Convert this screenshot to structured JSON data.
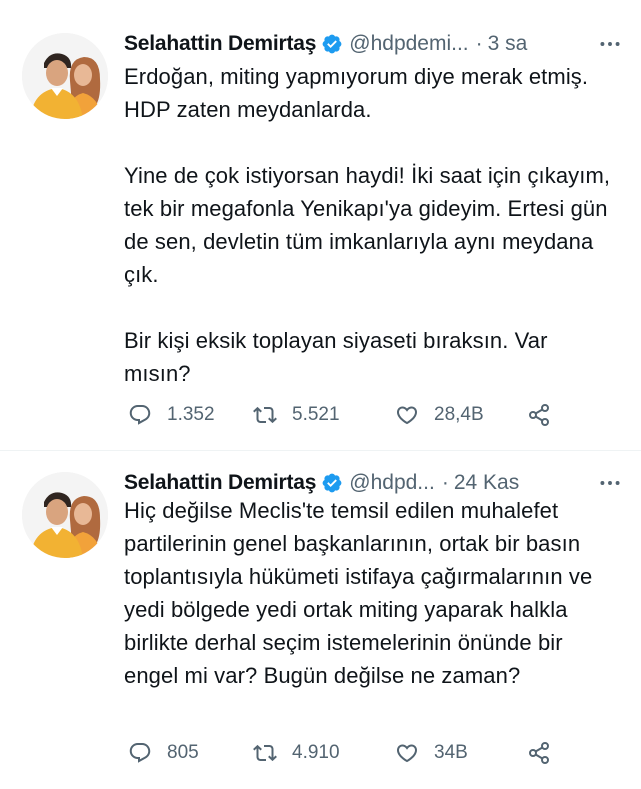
{
  "tweets": [
    {
      "author_name": "Selahattin Demirtaş",
      "handle": "@hdpdemi...",
      "separator": "·",
      "time": "3 sa",
      "text": "Erdoğan, miting yapmıyorum diye merak etmiş. HDP zaten meydanlarda.\n\nYine de çok istiyorsan haydi! İki saat için çıkayım, tek bir megafonla Yenikapı'ya gideyim. Ertesi gün de sen, devletin tüm imkanlarıyla aynı meydana çık.\n\nBir kişi eksik toplayan siyaseti bıraksın. Var mısın?",
      "replies": "1.352",
      "retweets": "5.521",
      "likes": "28,4B"
    },
    {
      "author_name": "Selahattin Demirtaş",
      "handle": "@hdpd...",
      "separator": "·",
      "time": "24 Kas",
      "text": "Hiç değilse Meclis'te temsil edilen muhalefet partilerinin genel başkanlarının, ortak bir basın toplantısıyla hükümeti istifaya çağırmalarının ve yedi bölgede yedi ortak miting yaparak halkla birlikte derhal seçim istemelerinin önünde bir engel mi var? Bugün değilse ne zaman?",
      "replies": "805",
      "retweets": "4.910",
      "likes": "34B"
    }
  ],
  "colors": {
    "text": "#0f1419",
    "secondary": "#536471",
    "verified": "#1d9bf0",
    "divider": "#eff3f4"
  },
  "icons": [
    "verified-badge-icon",
    "more-icon",
    "reply-icon",
    "retweet-icon",
    "like-icon",
    "share-icon",
    "avatar-photo"
  ]
}
